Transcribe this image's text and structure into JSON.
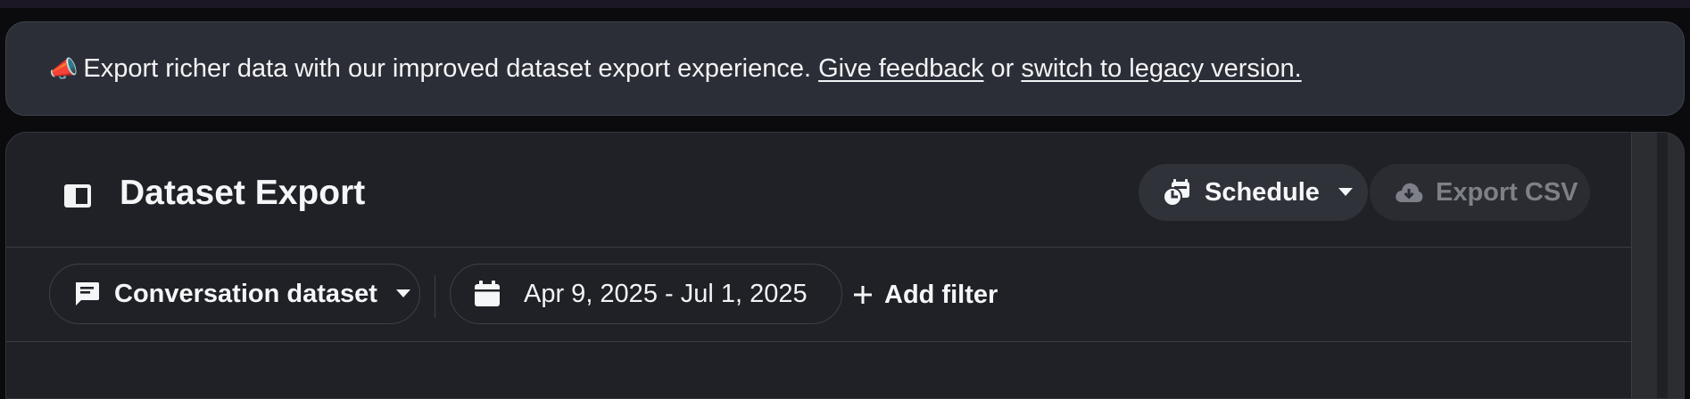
{
  "banner": {
    "emoji": "📣",
    "message": "Export richer data with our improved dataset export experience.",
    "feedback_link": "Give feedback",
    "or_text": "or",
    "legacy_link": "switch to legacy version."
  },
  "header": {
    "title": "Dataset Export",
    "schedule_label": "Schedule",
    "export_label": "Export CSV"
  },
  "filters": {
    "dataset_label": "Conversation dataset",
    "date_range": "Apr 9, 2025 - Jul 1, 2025",
    "add_filter_label": "Add filter"
  },
  "icons": {
    "sidebar": "sidebar-toggle-icon",
    "schedule": "calendar-clock-icon",
    "export": "cloud-download-icon",
    "dataset": "chat-message-icon",
    "date": "calendar-icon",
    "add": "plus-icon",
    "caret": "caret-down-icon"
  },
  "colors": {
    "background": "#0b0b0d",
    "banner_bg": "#2b2e36",
    "panel_bg": "#1f2126",
    "button_bg": "#2f3239",
    "disabled_text": "#7d8088"
  }
}
